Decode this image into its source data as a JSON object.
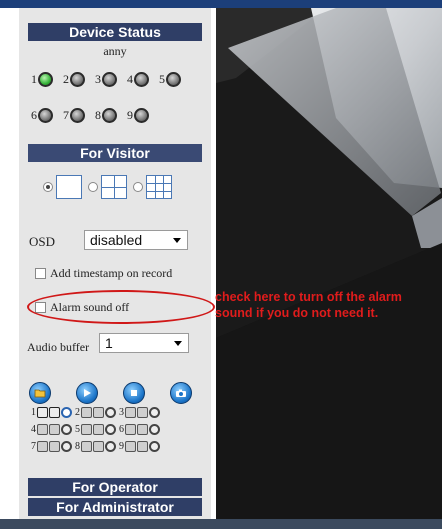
{
  "device_status": {
    "header": "Device Status",
    "device_name": "anny",
    "devices": [
      {
        "number": "1",
        "status": "online"
      },
      {
        "number": "2",
        "status": "offline"
      },
      {
        "number": "3",
        "status": "offline"
      },
      {
        "number": "4",
        "status": "offline"
      },
      {
        "number": "5",
        "status": "offline"
      },
      {
        "number": "6",
        "status": "offline"
      },
      {
        "number": "7",
        "status": "offline"
      },
      {
        "number": "8",
        "status": "offline"
      },
      {
        "number": "9",
        "status": "offline"
      }
    ]
  },
  "visitor": {
    "header": "For Visitor",
    "layouts": [
      {
        "icon": "layout-1-icon",
        "selected": true
      },
      {
        "icon": "layout-4-icon",
        "selected": false
      },
      {
        "icon": "layout-9-icon",
        "selected": false
      }
    ],
    "osd_label": "OSD",
    "osd_value": "disabled",
    "timestamp_label": "Add timestamp on record",
    "alarm_label": "Alarm sound off",
    "audio_label": "Audio buffer",
    "audio_value": "1",
    "controls": [
      "folder-icon",
      "play-icon",
      "stop-icon",
      "camera-icon"
    ],
    "channels": [
      "1",
      "2",
      "3",
      "4",
      "5",
      "6",
      "7",
      "8",
      "9"
    ]
  },
  "operator": {
    "header": "For Operator"
  },
  "administrator": {
    "header": "For Administrator"
  },
  "annotation": {
    "text": "check here to turn off the alarm sound if you do not need it.",
    "color": "#e01c1c"
  },
  "colors": {
    "header_bg": "#2f3e66",
    "panel_bg": "#e6e6e6",
    "online": "#37b43a"
  }
}
